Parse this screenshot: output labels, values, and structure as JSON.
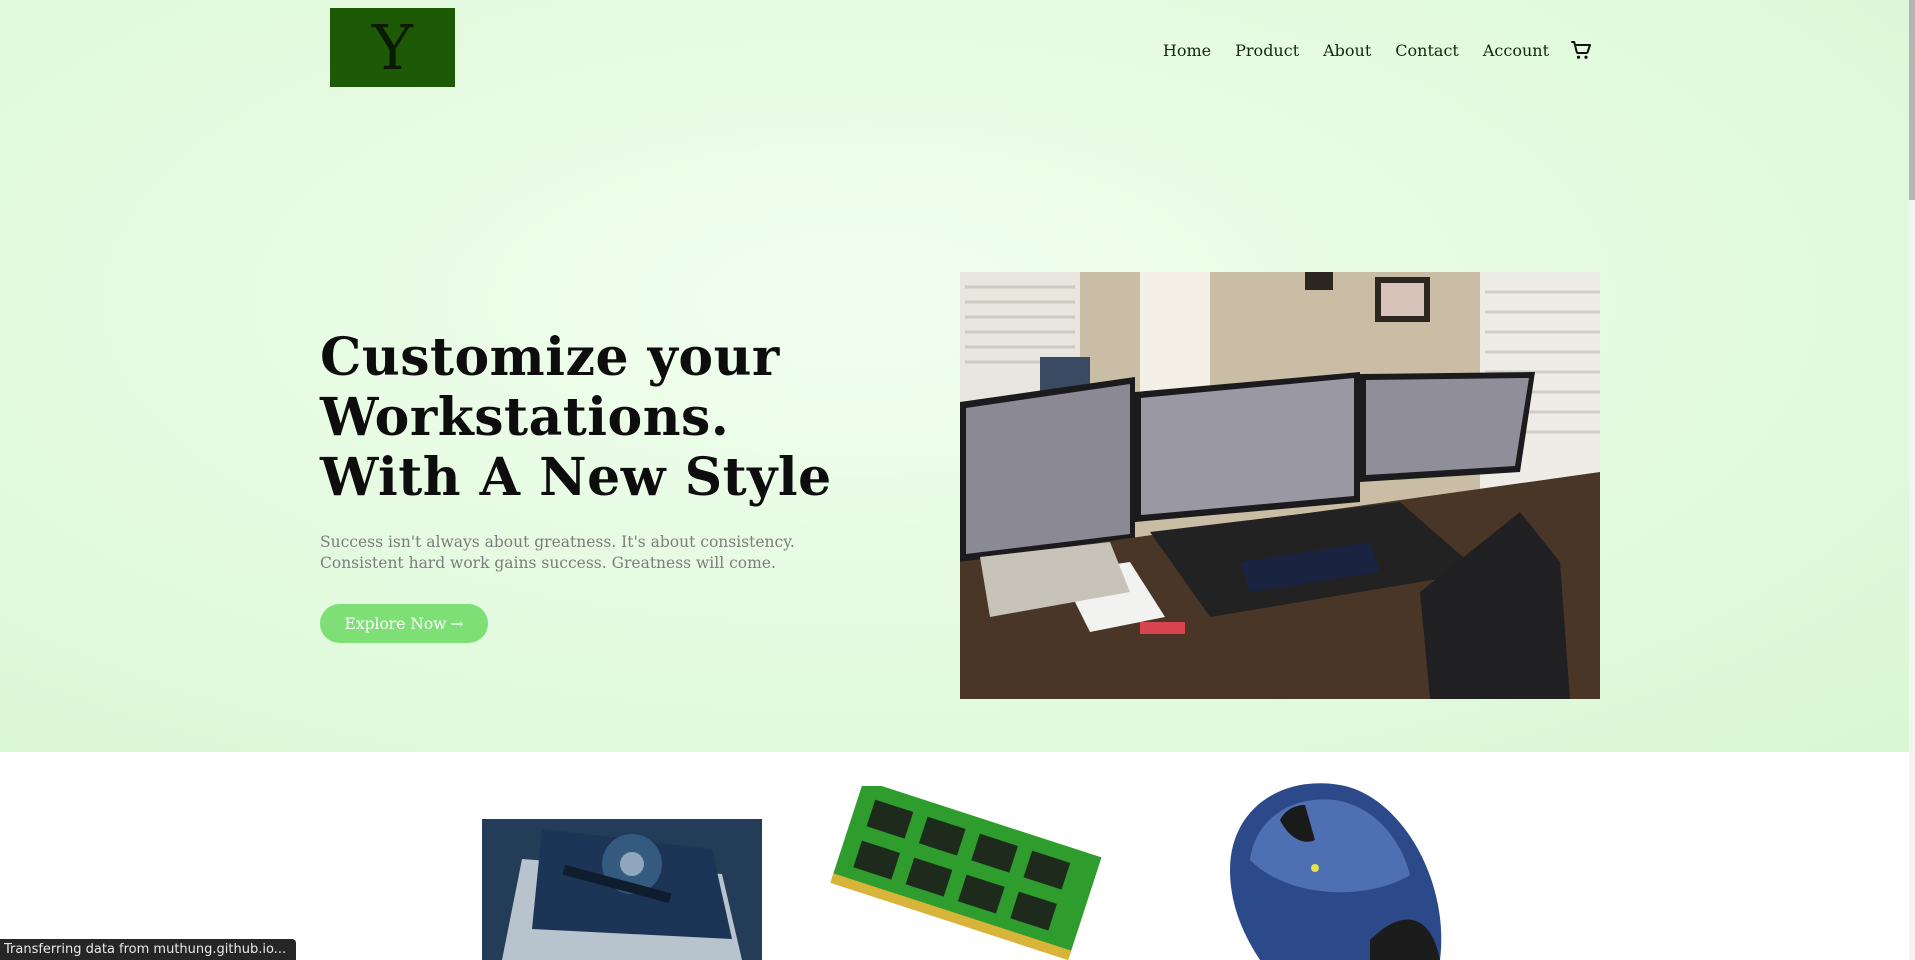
{
  "logo": {
    "letter": "Y"
  },
  "nav": {
    "items": [
      {
        "label": "Home"
      },
      {
        "label": "Product"
      },
      {
        "label": "About"
      },
      {
        "label": "Contact"
      },
      {
        "label": "Account"
      }
    ],
    "cart_icon": "shopping-cart-icon"
  },
  "hero": {
    "headline_line1": "Customize your",
    "headline_line2": "Workstations.",
    "headline_line3": "With A New Style",
    "subtext": "Success isn't always about greatness. It's about consistency. Consistent hard work gains success. Greatness will come.",
    "cta_label": "Explore Now",
    "cta_arrow": "→",
    "image": "workstation-desk-photo"
  },
  "products": [
    {
      "image": "hard-drive-photo"
    },
    {
      "image": "ram-module-photo"
    },
    {
      "image": "wireless-mouse-photo"
    }
  ],
  "status_bar": {
    "text": "Transferring data from muthung.github.io..."
  },
  "colors": {
    "hero_bg": "#e6fbe2",
    "logo_bg": "#1e5a05",
    "cta_bg": "#7ddf75",
    "subtext": "#7d7d7d"
  }
}
